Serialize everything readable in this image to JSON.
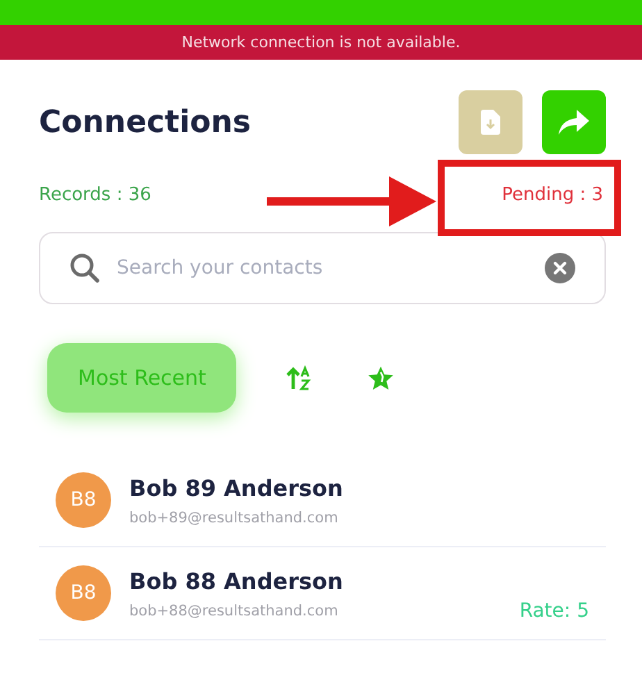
{
  "banner": {
    "message": "Network connection is not available."
  },
  "header": {
    "title": "Connections",
    "actions": [
      {
        "kind": "download",
        "disabled": true
      },
      {
        "kind": "share",
        "disabled": false
      }
    ]
  },
  "stats": {
    "records": "Records : 36",
    "pending": "Pending : 3"
  },
  "annotation": {
    "kind": "arrow-box"
  },
  "search": {
    "placeholder": "Search your contacts"
  },
  "filters": [
    {
      "kind": "text",
      "label": "Most Recent",
      "selected": true
    },
    {
      "kind": "sort",
      "selected": false
    },
    {
      "kind": "star",
      "selected": false
    }
  ],
  "contacts": [
    {
      "initials": "B8",
      "name": "Bob 89 Anderson",
      "email": "bob+89@resultsathand.com",
      "color": "#f0994a"
    },
    {
      "initials": "B8",
      "name": "Bob 88 Anderson",
      "email": "bob+88@resultsathand.com",
      "color": "#f0994a",
      "rate": "Rate: 5"
    }
  ]
}
